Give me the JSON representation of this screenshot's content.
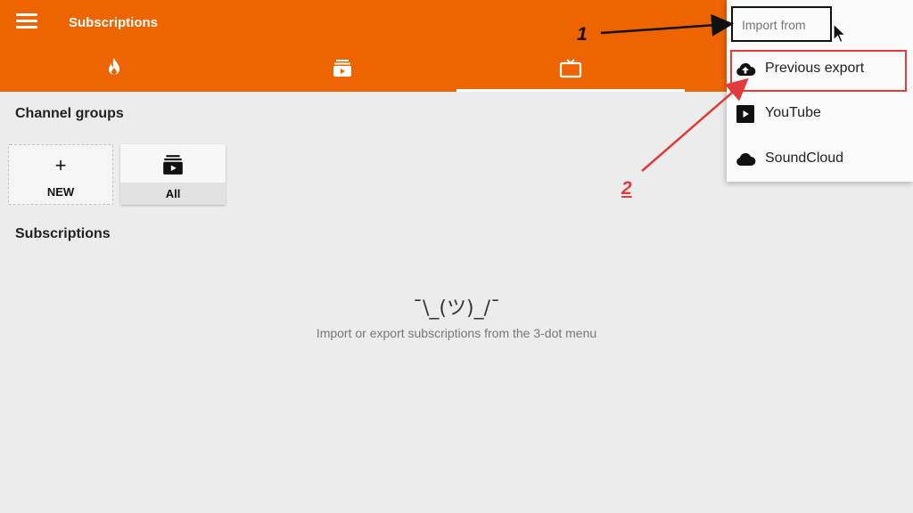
{
  "app": {
    "title": "Subscriptions",
    "tabs": [
      {
        "icon": "fire-icon"
      },
      {
        "icon": "subscriptions-icon"
      },
      {
        "icon": "tv-icon",
        "selected": true
      }
    ],
    "accent_color": "#ee6400"
  },
  "channel_groups": {
    "heading": "Channel groups",
    "cards": [
      {
        "symbol": "+",
        "label": "NEW"
      },
      {
        "label": "All"
      }
    ]
  },
  "subscriptions": {
    "heading": "Subscriptions",
    "empty_emoticon": "¯\\_(ツ)_/¯",
    "empty_message": "Import or export subscriptions from the 3-dot menu"
  },
  "import_menu": {
    "title": "Import from",
    "items": [
      {
        "label": "Previous export",
        "icon": "cloud-upload-icon"
      },
      {
        "label": "YouTube",
        "icon": "youtube-play-icon"
      },
      {
        "label": "SoundCloud",
        "icon": "cloud-icon"
      }
    ]
  },
  "annotations": {
    "step1": "1",
    "step2": "2",
    "step1_color": "#111111",
    "step2_color": "#e23b3b"
  }
}
